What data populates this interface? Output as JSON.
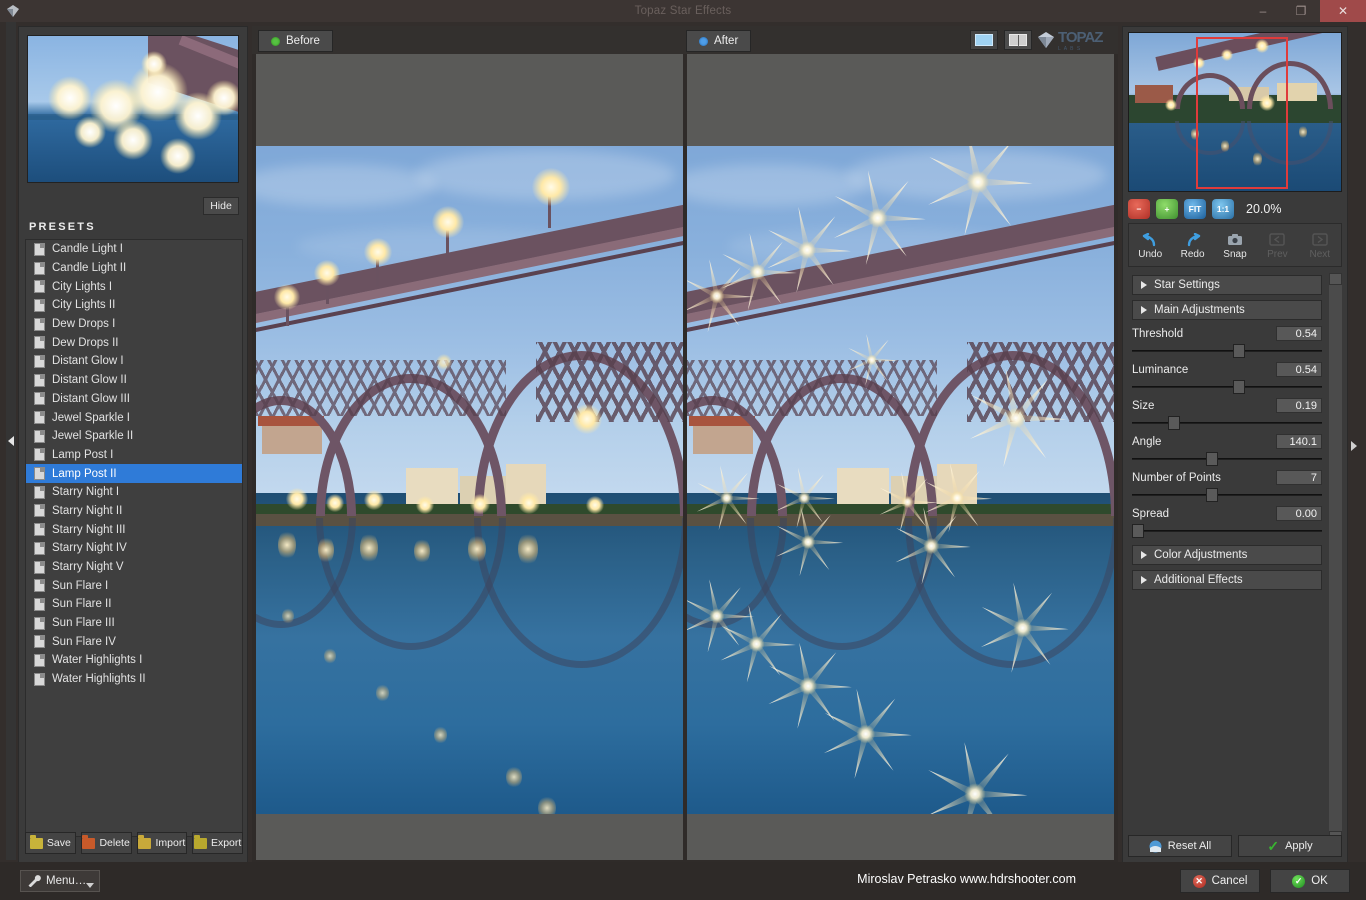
{
  "window": {
    "title": "Topaz Star Effects",
    "app_icon": "topaz-gem-icon",
    "minimize_label": "–",
    "maximize_label": "❐",
    "close_label": "✕"
  },
  "left_panel": {
    "preview_label": "preview-thumbnail",
    "hide_button": "Hide",
    "presets_header": "PRESETS",
    "presets": [
      {
        "label": "Candle Light I",
        "selected": false
      },
      {
        "label": "Candle Light II",
        "selected": false
      },
      {
        "label": "City Lights I",
        "selected": false
      },
      {
        "label": "City Lights II",
        "selected": false
      },
      {
        "label": "Dew Drops I",
        "selected": false
      },
      {
        "label": "Dew Drops II",
        "selected": false
      },
      {
        "label": "Distant Glow I",
        "selected": false
      },
      {
        "label": "Distant Glow II",
        "selected": false
      },
      {
        "label": "Distant Glow III",
        "selected": false
      },
      {
        "label": "Jewel Sparkle I",
        "selected": false
      },
      {
        "label": "Jewel Sparkle II",
        "selected": false
      },
      {
        "label": "Lamp Post I",
        "selected": false
      },
      {
        "label": "Lamp Post II",
        "selected": true
      },
      {
        "label": "Starry Night I",
        "selected": false
      },
      {
        "label": "Starry Night II",
        "selected": false
      },
      {
        "label": "Starry Night III",
        "selected": false
      },
      {
        "label": "Starry Night IV",
        "selected": false
      },
      {
        "label": "Starry Night V",
        "selected": false
      },
      {
        "label": "Sun Flare I",
        "selected": false
      },
      {
        "label": "Sun Flare II",
        "selected": false
      },
      {
        "label": "Sun Flare III",
        "selected": false
      },
      {
        "label": "Sun Flare IV",
        "selected": false
      },
      {
        "label": "Water Highlights I",
        "selected": false
      },
      {
        "label": "Water Highlights II",
        "selected": false
      }
    ],
    "preset_buttons": [
      {
        "label": "Save",
        "icon": "folder-save-icon",
        "color": "#c8b33a"
      },
      {
        "label": "Delete",
        "icon": "folder-delete-icon",
        "color": "#c85a2a"
      },
      {
        "label": "Import",
        "icon": "folder-import-icon",
        "color": "#c8a93a"
      },
      {
        "label": "Export",
        "icon": "folder-export-icon",
        "color": "#b8a82e"
      }
    ]
  },
  "canvas": {
    "tabs": [
      {
        "label": "Before",
        "dot": "green-status-dot",
        "dot_color": "#56c341"
      },
      {
        "label": "After",
        "dot": "blue-status-dot",
        "dot_color": "#4f9ee8"
      }
    ],
    "view_buttons": [
      {
        "name": "single-view-button",
        "active": false
      },
      {
        "name": "split-view-button",
        "active": true
      }
    ],
    "brand": "TOPAZ",
    "brand_sub": "L A B S"
  },
  "right_panel": {
    "navigator_label": "navigator-thumbnail",
    "zoom_buttons": [
      {
        "name": "zoom-out-button",
        "glyph": "−"
      },
      {
        "name": "zoom-in-button",
        "glyph": "+"
      },
      {
        "name": "zoom-fit-button",
        "glyph": "FIT"
      },
      {
        "name": "zoom-actual-button",
        "glyph": "1:1"
      }
    ],
    "zoom_value": "20.0%",
    "tools": [
      {
        "label": "Undo",
        "icon": "undo-arrow-icon",
        "enabled": true
      },
      {
        "label": "Redo",
        "icon": "redo-arrow-icon",
        "enabled": true
      },
      {
        "label": "Snap",
        "icon": "camera-snap-icon",
        "enabled": true
      },
      {
        "label": "Prev",
        "icon": "prev-snapshot-icon",
        "enabled": false
      },
      {
        "label": "Next",
        "icon": "next-snapshot-icon",
        "enabled": false
      }
    ],
    "sections": {
      "star_settings": "Star Settings",
      "main_adjustments": "Main Adjustments",
      "color_adjustments": "Color Adjustments",
      "additional_effects": "Additional Effects"
    },
    "sliders": [
      {
        "name": "Threshold",
        "value": "0.54",
        "pct": 53
      },
      {
        "name": "Luminance",
        "value": "0.54",
        "pct": 53
      },
      {
        "name": "Size",
        "value": "0.19",
        "pct": 19
      },
      {
        "name": "Angle",
        "value": "140.1",
        "pct": 39
      },
      {
        "name": "Number of Points",
        "value": "7",
        "pct": 39
      },
      {
        "name": "Spread",
        "value": "0.00",
        "pct": 1
      }
    ],
    "reset_button": "Reset All",
    "apply_button": "Apply"
  },
  "status_bar": {
    "menu_button": "Menu…",
    "credit": "Miroslav Petrasko www.hdrshooter.com",
    "cancel_button": "Cancel",
    "ok_button": "OK"
  }
}
